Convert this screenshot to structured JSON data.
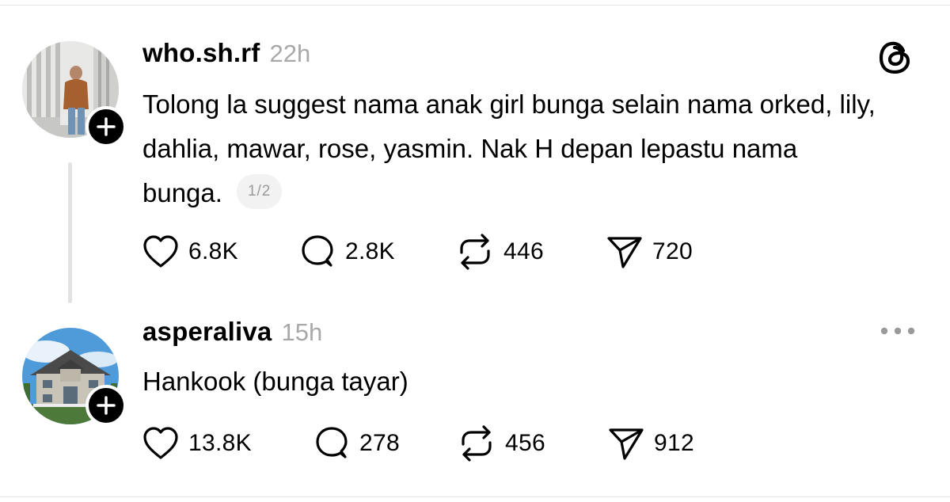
{
  "posts": [
    {
      "username": "who.sh.rf",
      "time": "22h",
      "text": "Tolong la suggest nama anak girl bunga selain nama orked, lily, dahlia, mawar, rose, yasmin. Nak H depan lepastu nama bunga.",
      "page_indicator": "1/2",
      "likes": "6.8K",
      "replies": "2.8K",
      "reposts": "446",
      "shares": "720",
      "corner_icon": "threads-logo-icon"
    },
    {
      "username": "asperaliva",
      "time": "15h",
      "text": "Hankook (bunga tayar)",
      "likes": "13.8K",
      "replies": "278",
      "reposts": "456",
      "shares": "912",
      "corner_icon": "more-options-icon"
    }
  ],
  "colors": {
    "text": "#000000",
    "muted": "#a8a8a8",
    "divider": "#e6e6e6",
    "thread_line": "#e2e2e2",
    "badge_bg": "#f2f2f2"
  }
}
